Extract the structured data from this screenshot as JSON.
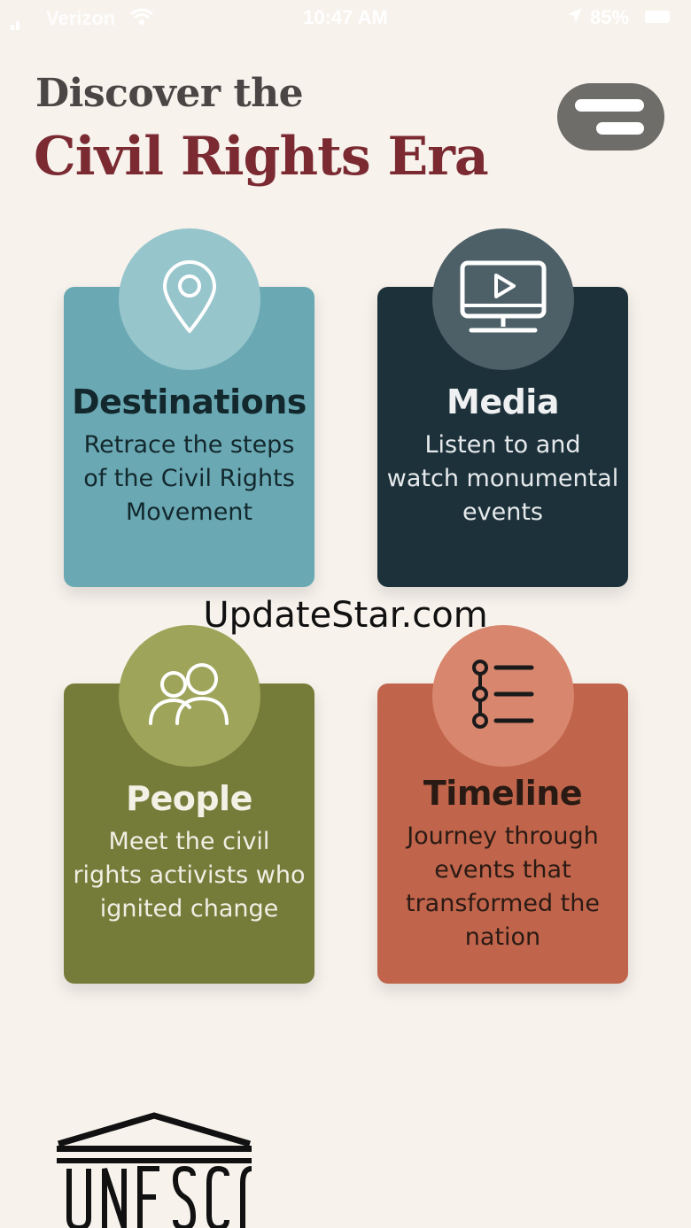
{
  "status_bar": {
    "carrier": "Verizon",
    "time": "10:47 AM",
    "battery": "85%"
  },
  "header": {
    "title_line1": "Discover the",
    "title_line2": "Civil Rights Era",
    "menu_icon": "menu-icon"
  },
  "cards": [
    {
      "title": "Destinations",
      "description": "Retrace the steps of the Civil Rights Movement",
      "icon": "map-pin-icon",
      "color": "#6aa9b4"
    },
    {
      "title": "Media",
      "description": "Listen to and watch monumental events",
      "icon": "video-monitor-icon",
      "color": "#1d313a"
    },
    {
      "title": "People",
      "description": "Meet the civil rights activists who ignited change",
      "icon": "people-icon",
      "color": "#757c3a"
    },
    {
      "title": "Timeline",
      "description": "Journey through events that transformed the nation",
      "icon": "timeline-list-icon",
      "color": "#c0654b"
    }
  ],
  "watermark": "UpdateStar.com",
  "footer": {
    "logo_text": "UNESCO"
  }
}
